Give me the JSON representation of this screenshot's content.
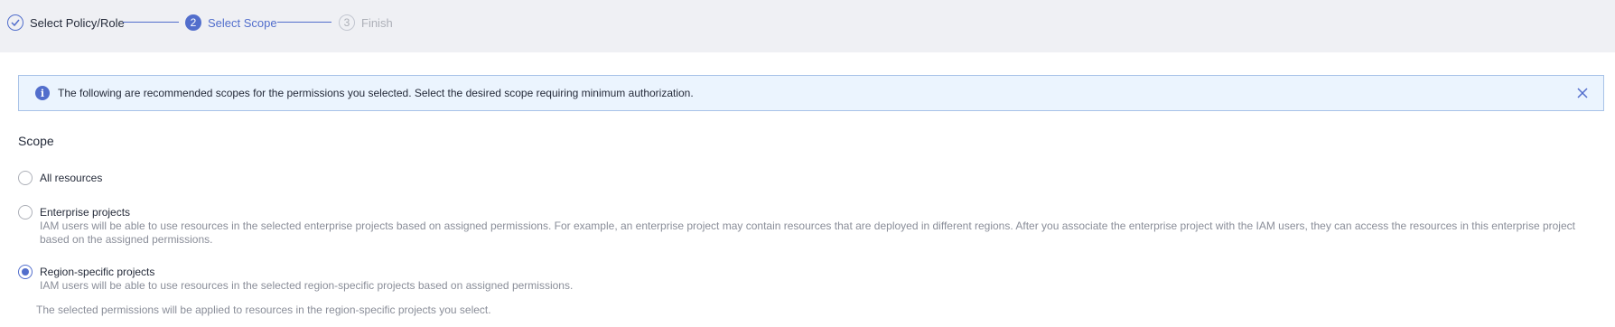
{
  "steps": [
    {
      "label": "Select Policy/Role",
      "state": "done"
    },
    {
      "label": "Select Scope",
      "number": "2",
      "state": "active"
    },
    {
      "label": "Finish",
      "number": "3",
      "state": "todo"
    }
  ],
  "alert": {
    "icon": "info-icon",
    "text": "The following are recommended scopes for the permissions you selected. Select the desired scope requiring minimum authorization.",
    "close_icon": "close-icon"
  },
  "scope": {
    "title": "Scope",
    "options": [
      {
        "label": "All resources",
        "description": "",
        "selected": false
      },
      {
        "label": "Enterprise projects",
        "description": "IAM users will be able to use resources in the selected enterprise projects based on assigned permissions. For example, an enterprise project may contain resources that are deployed in different regions. After you associate the enterprise project with the IAM users, they can access the resources in this enterprise project based on the assigned permissions.",
        "selected": false
      },
      {
        "label": "Region-specific projects",
        "description": "IAM users will be able to use resources in the selected region-specific projects based on assigned permissions.",
        "selected": true
      }
    ],
    "note": "The selected permissions will be applied to resources in the region-specific projects you select."
  },
  "colors": {
    "accent": "#526ecc",
    "alert_bg": "#ebf4fe",
    "step_bg": "#eff0f4"
  }
}
